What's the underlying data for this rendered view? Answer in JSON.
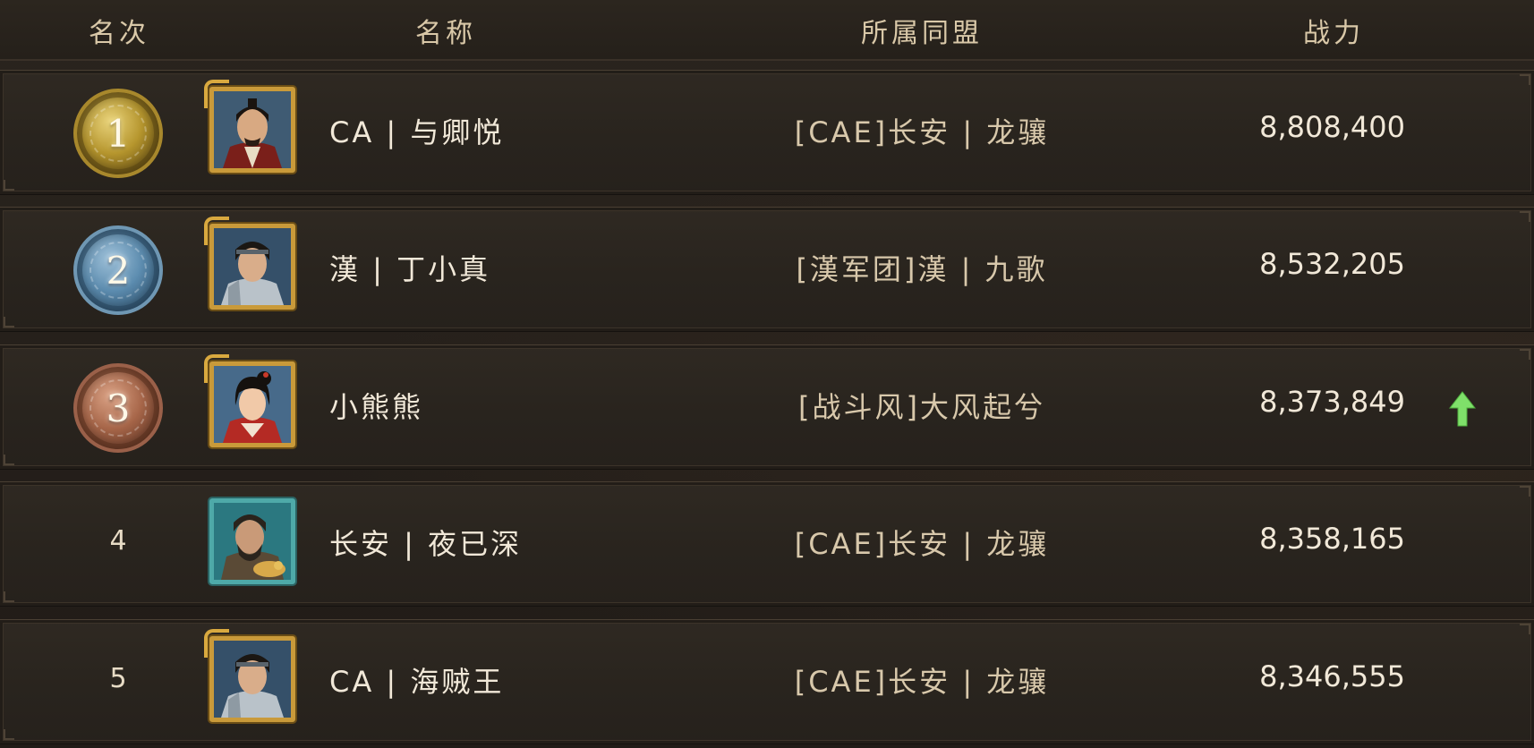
{
  "header": {
    "rank": "名次",
    "name": "名称",
    "alliance": "所属同盟",
    "power": "战力"
  },
  "rows": [
    {
      "rank": "1",
      "medal": "gold",
      "name": "CA | 与卿悦",
      "alliance": "[CAE]长安 | 龙骧",
      "power": "8,808,400",
      "trend": ""
    },
    {
      "rank": "2",
      "medal": "silver",
      "name": "漢 | 丁小真",
      "alliance": "[漢军团]漢 | 九歌",
      "power": "8,532,205",
      "trend": ""
    },
    {
      "rank": "3",
      "medal": "bronze",
      "name": "小熊熊",
      "alliance": "[战斗风]大风起兮",
      "power": "8,373,849",
      "trend": "up"
    },
    {
      "rank": "4",
      "medal": "",
      "name": "长安 | 夜已深",
      "alliance": "[CAE]长安 | 龙骧",
      "power": "8,358,165",
      "trend": ""
    },
    {
      "rank": "5",
      "medal": "",
      "name": "CA | 海贼王",
      "alliance": "[CAE]长安 | 龙骧",
      "power": "8,346,555",
      "trend": ""
    }
  ],
  "colors": {
    "trend_up": "#7fe06a",
    "gold": "#b6962e",
    "silver": "#5d8db0",
    "bronze": "#a8674a"
  },
  "icons": {
    "trend": "arrow-up-icon",
    "avatar": "general-portrait-icon",
    "medal": "dragon-medal-icon"
  }
}
